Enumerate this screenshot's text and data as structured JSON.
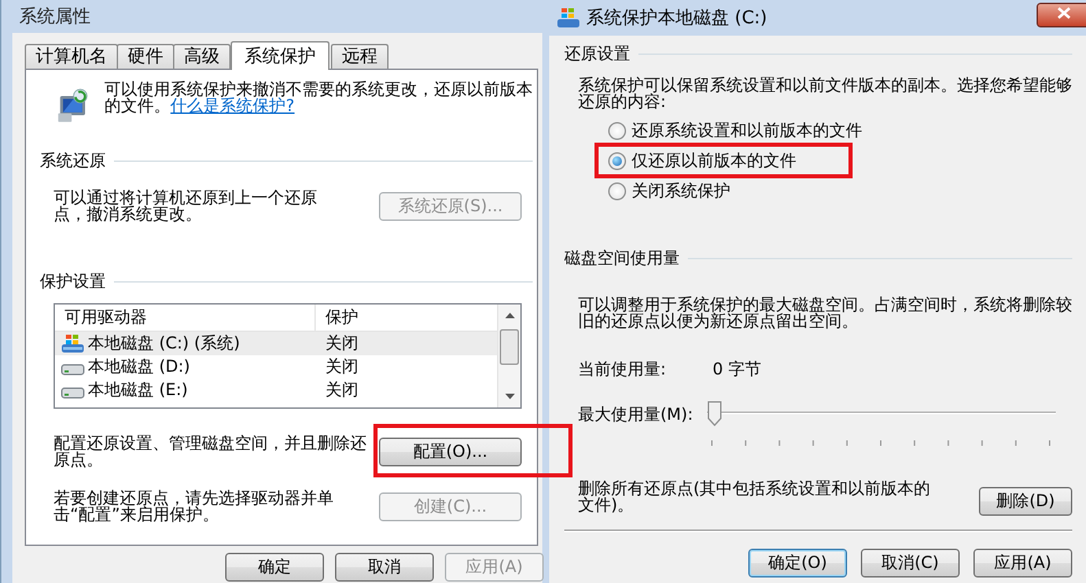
{
  "system_properties": {
    "title": "系统属性",
    "tabs": [
      {
        "label": "计算机名",
        "selected": false
      },
      {
        "label": "硬件",
        "selected": false
      },
      {
        "label": "高级",
        "selected": false
      },
      {
        "label": "系统保护",
        "selected": true
      },
      {
        "label": "远程",
        "selected": false
      }
    ],
    "intro": {
      "text": "可以使用系统保护来撤消不需要的系统更改，还原以前版本的文件。",
      "link": "什么是系统保护?"
    },
    "system_restore": {
      "heading": "系统还原",
      "description": "可以通过将计算机还原到上一个还原点，撤消系统更改。",
      "button": {
        "label": "系统还原(S)...",
        "disabled": true
      }
    },
    "protection_settings": {
      "heading": "保护设置",
      "columns": [
        "可用驱动器",
        "保护"
      ],
      "rows": [
        {
          "drive": "本地磁盘 (C:) (系统)",
          "protection": "关闭",
          "kind": "system",
          "selected": true
        },
        {
          "drive": "本地磁盘 (D:)",
          "protection": "关闭",
          "kind": "disk",
          "selected": false
        },
        {
          "drive": "本地磁盘 (E:)",
          "protection": "关闭",
          "kind": "disk",
          "selected": false
        }
      ],
      "configure": {
        "description": "配置还原设置、管理磁盘空间，并且删除还原点。",
        "button": {
          "label": "配置(O)...",
          "disabled": false,
          "highlighted": true
        }
      },
      "create": {
        "description": "若要创建还原点，请先选择驱动器并单击“配置”来启用保护。",
        "button": {
          "label": "创建(C)...",
          "disabled": true
        }
      }
    },
    "buttons": [
      {
        "label": "确定",
        "disabled": false
      },
      {
        "label": "取消",
        "disabled": false
      },
      {
        "label": "应用(A)",
        "disabled": true
      }
    ]
  },
  "restore_dialog": {
    "title": "系统保护本地磁盘 (C:)",
    "restore_settings": {
      "heading": "还原设置",
      "description": "系统保护可以保留系统设置和以前文件版本的副本。选择您希望能够还原的内容:",
      "options": [
        {
          "label": "还原系统设置和以前版本的文件",
          "selected": false,
          "highlighted": false
        },
        {
          "label": "仅还原以前版本的文件",
          "selected": true,
          "highlighted": true
        },
        {
          "label": "关闭系统保护",
          "selected": false,
          "highlighted": false
        }
      ]
    },
    "disk_usage": {
      "heading": "磁盘空间使用量",
      "description": "可以调整用于系统保护的最大磁盘空间。占满空间时，系统将删除较旧的还原点以便为新还原点留出空间。",
      "current_usage": {
        "label": "当前使用量:",
        "value": "0 字节"
      },
      "max_usage": {
        "label": "最大使用量(M):",
        "level": 0
      }
    },
    "delete": {
      "description": "删除所有还原点(其中包括系统设置和以前版本的文件)。",
      "button": {
        "label": "删除(D)",
        "disabled": false
      }
    },
    "buttons": [
      {
        "label": "确定(O)",
        "disabled": false,
        "default": true
      },
      {
        "label": "取消(C)",
        "disabled": false,
        "default": false
      },
      {
        "label": "应用(A)",
        "disabled": false,
        "default": false
      }
    ]
  }
}
